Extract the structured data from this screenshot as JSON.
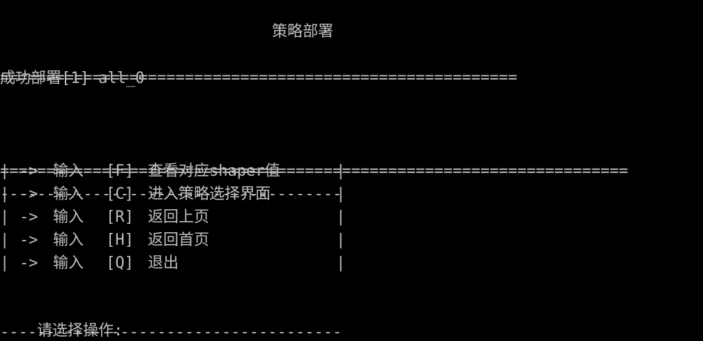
{
  "colors": {
    "background": "#000000",
    "foreground": "#c0c0c0"
  },
  "header": {
    "fill": "========================================================",
    "title": "策略部署"
  },
  "result": {
    "text": "成功部署[1] all_0"
  },
  "footer": {
    "fill": "========================================================================"
  },
  "menu": {
    "border_top": "----------------------------------------",
    "border_bottom": "----------------------------------------",
    "side": "|",
    "arrow": "->",
    "input_word": "输入",
    "items": [
      {
        "key": "[F]",
        "label": "查看对应shaper值"
      },
      {
        "key": "[C]",
        "label": "进入策略选择界面"
      },
      {
        "key": "[R]",
        "label": "返回上页"
      },
      {
        "key": "[H]",
        "label": "返回首页"
      },
      {
        "key": "[Q]",
        "label": "退出"
      }
    ]
  },
  "prompt": {
    "text": "请选择操作:"
  }
}
